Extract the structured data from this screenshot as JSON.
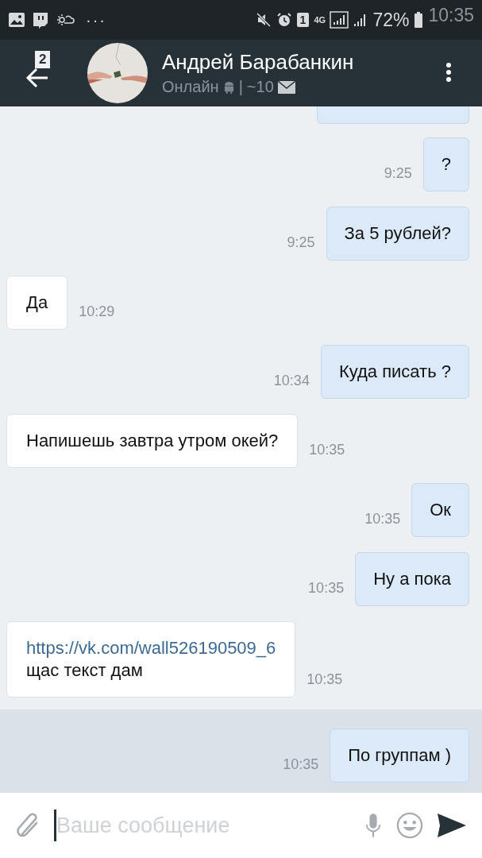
{
  "status_bar": {
    "dots": "···",
    "sim": "1",
    "network": "4G",
    "battery": "72%",
    "time": "10:35"
  },
  "header": {
    "unread_badge": "2",
    "name": "Андрей Барабанкин",
    "status": "Онлайн",
    "separator": "|",
    "count": "~10"
  },
  "messages": [
    {
      "kind": "outgoing",
      "text": "?",
      "time": "9:25",
      "selected": false
    },
    {
      "kind": "outgoing",
      "text": "За 5 рублей?",
      "time": "9:25",
      "selected": false
    },
    {
      "kind": "incoming",
      "text": "Да",
      "time": "10:29",
      "selected": false
    },
    {
      "kind": "outgoing",
      "text": "Куда писать ?",
      "time": "10:34",
      "selected": false
    },
    {
      "kind": "incoming",
      "text": "Напишешь завтра утром окей?",
      "time": "10:35",
      "selected": false
    },
    {
      "kind": "outgoing",
      "text": "Ок",
      "time": "10:35",
      "selected": false
    },
    {
      "kind": "outgoing",
      "text": "Ну а пока",
      "time": "10:35",
      "selected": false
    },
    {
      "kind": "incoming",
      "link": "https://vk.com/wall526190509_6",
      "text": "щас текст дам",
      "time": "10:35",
      "selected": false
    },
    {
      "kind": "outgoing",
      "text": "По группам )",
      "time": "10:35",
      "selected": true
    }
  ],
  "composer": {
    "placeholder": "Ваше сообщение"
  }
}
